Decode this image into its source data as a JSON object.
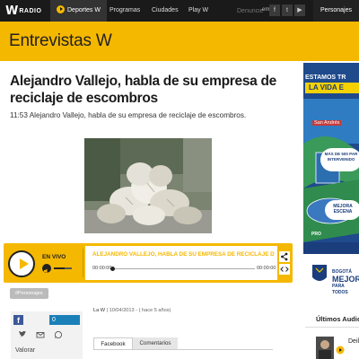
{
  "nav": {
    "logo_mark": "W",
    "logo_word": "RADIO",
    "items": [
      "Deportes W",
      "Programas",
      "Ciudades",
      "Play W"
    ],
    "search_placeholder": "Denuncie",
    "search_suffix": "em",
    "social": [
      "f",
      "t",
      "▶"
    ],
    "personajes": "Personajes"
  },
  "section": {
    "title": "Entrevistas W"
  },
  "article": {
    "headline": "Alejandro Vallejo, habla de su empresa de reciclaje de escombros",
    "summary": "11:53 Alejandro Vallejo, habla de su empresa de reciclaje de escombros.",
    "tag": "#Personajes",
    "meta_source": "La W",
    "meta_date": "10/04/2013 - ( hace 5 años)"
  },
  "player": {
    "live_label": "EN VIVO",
    "track_title": "ALEJANDRO VALLEJO, HABLA DE SU EMPRESA DE RECICLAJE DE ES",
    "time_current": "00:00:00",
    "time_total": "00:00:00",
    "progress": 0,
    "volume": 0.6,
    "accent": "#f5b800"
  },
  "social_box": {
    "fb_count": "0",
    "valorar": "Valorar"
  },
  "comments": {
    "tabs": [
      "Facebook",
      "Comentarios"
    ]
  },
  "ad": {
    "line1": "ESTAMOS TR",
    "line2": "LA VIDA E",
    "location": "San Andrés",
    "bubble1": "MÁS DE 500 PAR INTERVENIDO",
    "bubble2": "MEJORA ESCENA",
    "pro": "PRO",
    "brand_top": "BOGOTÁ",
    "brand_mid": "MEJOR",
    "brand_bottom": "PARA TODOS"
  },
  "sidebar": {
    "ultimos": "Últimos Audio",
    "ultimos_item": "Deil la F"
  },
  "colors": {
    "brand_yellow": "#f5b800",
    "nav_bg": "#1a1a1a",
    "fb_blue": "#3b5998"
  }
}
